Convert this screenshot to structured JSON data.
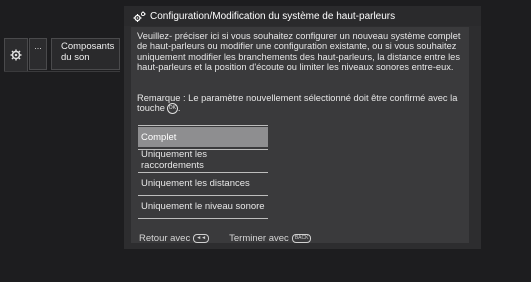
{
  "nav": {
    "dots_label": "...",
    "item_label": "Composants du son"
  },
  "dialog": {
    "title": "Configuration/Modification du système de haut-parleurs",
    "description": "Veuillez- préciser ici si vous souhaitez configurer un nouveau système complet de haut-parleurs ou modifier une configuration existante, ou si vous souhaitez uniquement modifier les branchements des haut-parleurs, la distance entre les haut-parleurs et la position d'écoute ou limiter les niveaux sonores entre-eux.",
    "note": "Remarque : Le paramètre nouvellement sélectionné doit être confirmé avec la touche",
    "ok_key": "OK",
    "options": [
      {
        "label": "Complet",
        "selected": true
      },
      {
        "label": "Uniquement les raccordements",
        "selected": false
      },
      {
        "label": "Uniquement les distances",
        "selected": false
      },
      {
        "label": "Uniquement le niveau sonore",
        "selected": false
      }
    ],
    "footer": {
      "back_label": "Retour avec",
      "back_key": "◄◄",
      "end_label": "Terminer avec",
      "end_key": "BACK"
    }
  },
  "colors": {
    "selected_bg": "#8e8e90",
    "dialog_bg": "#3a3a3c",
    "screen_bg": "#1d1d1f"
  }
}
